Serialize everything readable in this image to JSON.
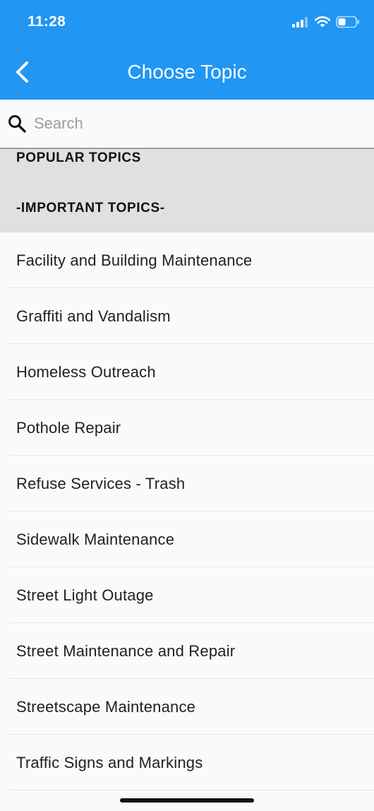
{
  "status_bar": {
    "time": "11:28",
    "icons": [
      "cellular-signal-icon",
      "wifi-icon",
      "battery-icon"
    ]
  },
  "header": {
    "title": "Choose Topic",
    "back_icon": "chevron-left-icon",
    "background_color": "#2196F3"
  },
  "search": {
    "placeholder": "Search",
    "value": "",
    "icon": "search-icon"
  },
  "sections": {
    "popular": "POPULAR TOPICS",
    "important": "-IMPORTANT TOPICS-"
  },
  "topics": [
    "Facility and Building Maintenance",
    "Graffiti and Vandalism",
    "Homeless Outreach",
    "Pothole Repair",
    "Refuse Services - Trash",
    "Sidewalk Maintenance",
    "Street Light Outage",
    "Street Maintenance and Repair",
    "Streetscape Maintenance",
    "Traffic Signs and Markings"
  ]
}
